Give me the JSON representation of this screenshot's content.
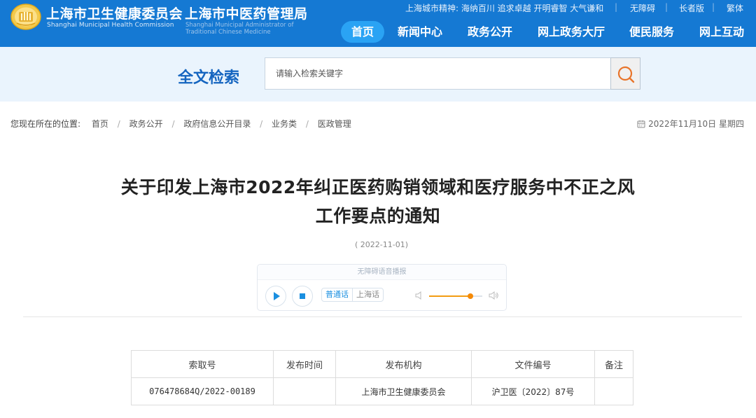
{
  "header": {
    "org1_name": "上海市卫生健康委员会",
    "org1_name_en": "Shanghai Municipal Health Commission",
    "org2_name": "上海市中医药管理局",
    "org2_name_en": "Shanghai Municipal Administrator of Traditional Chinese Medicine",
    "spirit_text": "上海城市精神: 海纳百川 追求卓越 开明睿智 大气谦和",
    "links": [
      "无障碍",
      "长者版",
      "繁体"
    ],
    "nav": [
      "首页",
      "新闻中心",
      "政务公开",
      "网上政务大厅",
      "便民服务",
      "网上互动"
    ],
    "nav_active_index": 0,
    "colors": {
      "header_bg": "#1579d3",
      "nav_active": "#2aa3f4"
    }
  },
  "search": {
    "title": "全文检索",
    "placeholder": "请输入检索关键字"
  },
  "breadcrumb": {
    "prefix": "您现在所在的位置:",
    "items": [
      "首页",
      "政务公开",
      "政府信息公开目录",
      "业务类",
      "医政管理"
    ]
  },
  "current_date": "2022年11月10日 星期四",
  "article": {
    "title_line1": "关于印发上海市2022年纠正医药购销领域和医疗服务中不正之风",
    "title_line2": "工作要点的通知",
    "publish_date": "( 2022-11-01)"
  },
  "player": {
    "header": "无障碍语音播报",
    "lang_mandarin": "普通话",
    "lang_shanghainese": "上海话",
    "volume_percent": 78
  },
  "info_table": {
    "headers": [
      "索取号",
      "发布时间",
      "发布机构",
      "文件编号",
      "备注"
    ],
    "rows": [
      [
        "076478684Q/2022-00189",
        "",
        "上海市卫生健康委员会",
        "沪卫医〔2022〕87号",
        ""
      ]
    ]
  }
}
